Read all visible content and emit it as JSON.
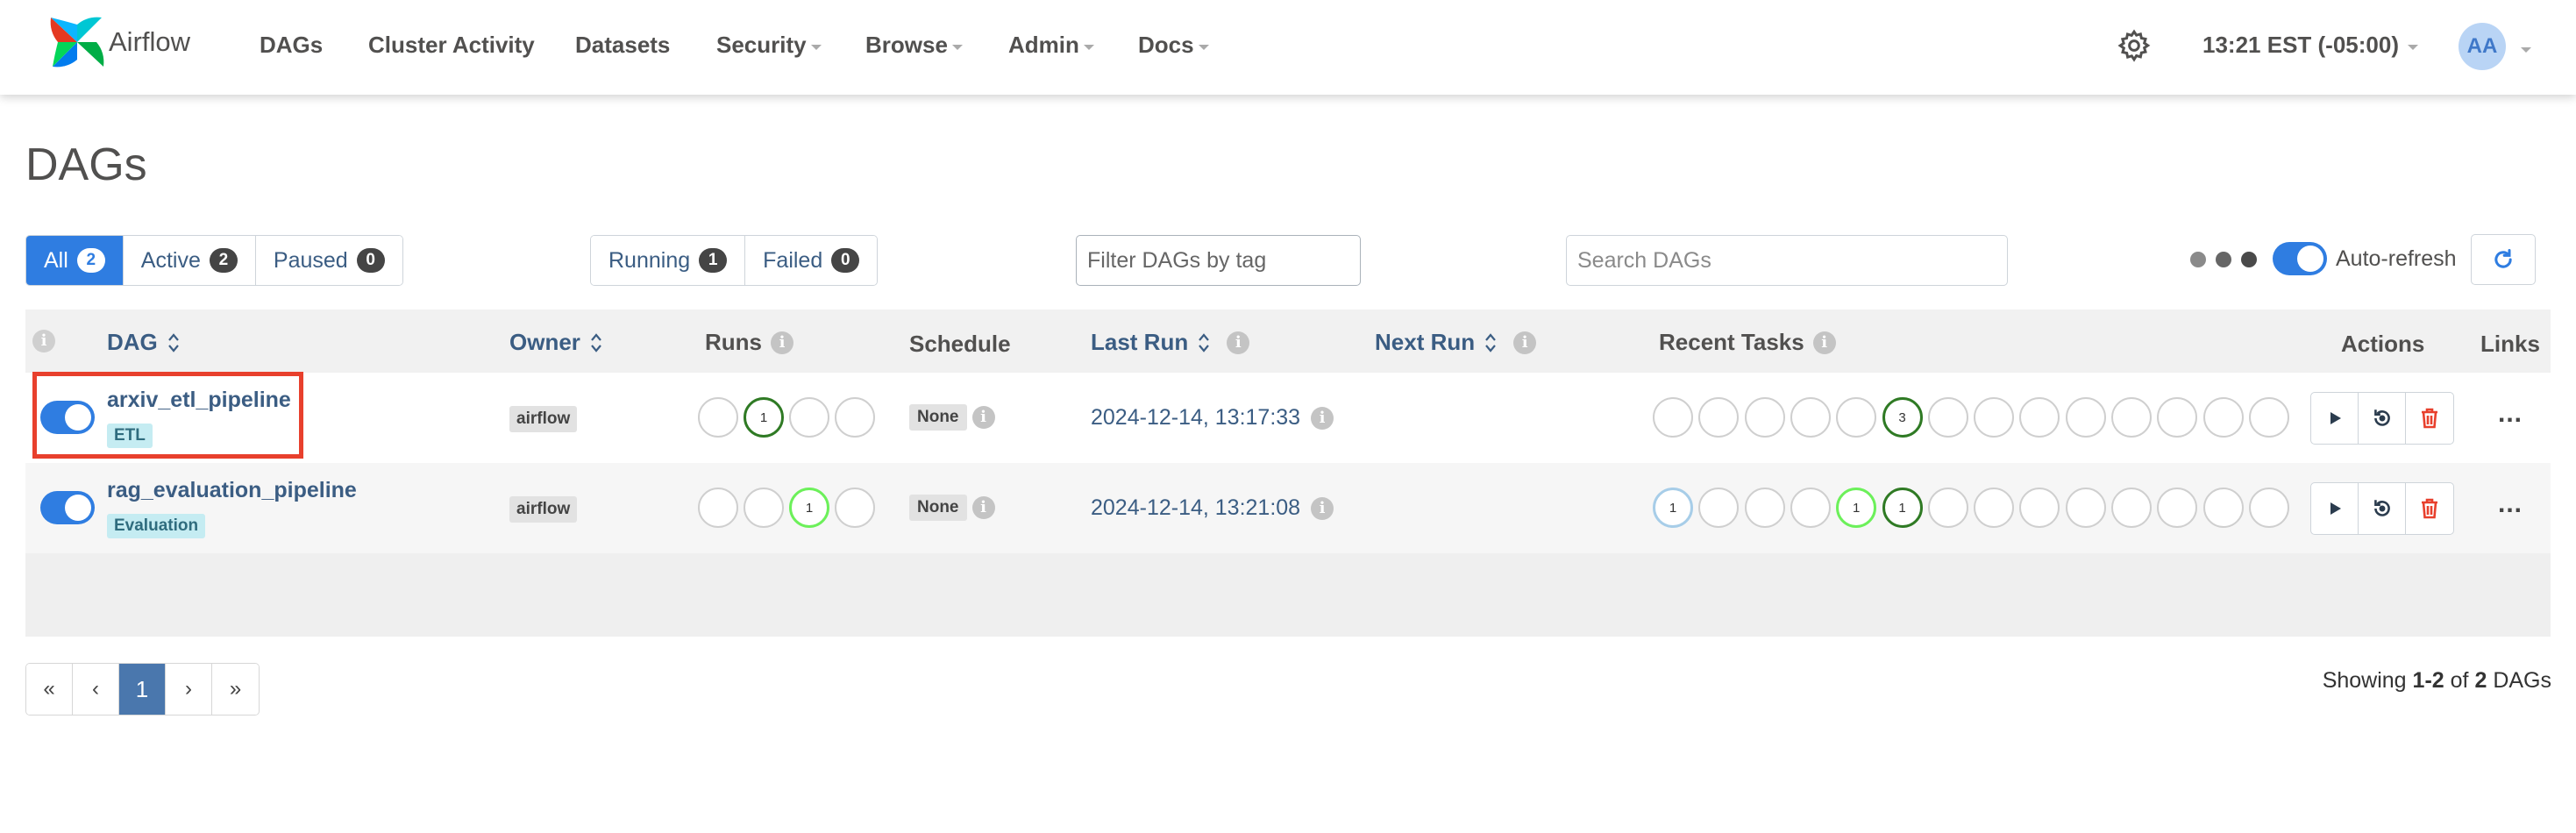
{
  "brand": {
    "name": "Airflow"
  },
  "nav": {
    "items": [
      {
        "label": "DAGs",
        "dropdown": false
      },
      {
        "label": "Cluster Activity",
        "dropdown": false
      },
      {
        "label": "Datasets",
        "dropdown": false
      },
      {
        "label": "Security",
        "dropdown": true
      },
      {
        "label": "Browse",
        "dropdown": true
      },
      {
        "label": "Admin",
        "dropdown": true
      },
      {
        "label": "Docs",
        "dropdown": true
      }
    ],
    "time": "13:21 EST (-05:00)",
    "user_initials": "AA"
  },
  "page": {
    "title": "DAGs"
  },
  "filters": {
    "status": [
      {
        "label": "All",
        "count": "2",
        "active": true
      },
      {
        "label": "Active",
        "count": "2",
        "active": false
      },
      {
        "label": "Paused",
        "count": "0",
        "active": false
      }
    ],
    "runs": [
      {
        "label": "Running",
        "count": "1"
      },
      {
        "label": "Failed",
        "count": "0"
      }
    ],
    "tag_placeholder": "Filter DAGs by tag",
    "search_placeholder": "Search DAGs",
    "auto_refresh_label": "Auto-refresh",
    "auto_refresh_on": true
  },
  "table": {
    "headers": {
      "dag": "DAG",
      "owner": "Owner",
      "runs": "Runs",
      "schedule": "Schedule",
      "last_run": "Last Run",
      "next_run": "Next Run",
      "recent_tasks": "Recent Tasks",
      "actions": "Actions",
      "links": "Links"
    },
    "rows": [
      {
        "dag_id": "arxiv_etl_pipeline",
        "tag": "ETL",
        "enabled": true,
        "owner": "airflow",
        "runs": [
          {
            "label": "",
            "state": "none"
          },
          {
            "label": "1",
            "state": "success"
          },
          {
            "label": "",
            "state": "none"
          },
          {
            "label": "",
            "state": "none"
          }
        ],
        "schedule": "None",
        "last_run": "2024-12-14, 13:17:33",
        "next_run": "",
        "recent_tasks": [
          {
            "label": "",
            "state": "none"
          },
          {
            "label": "",
            "state": "none"
          },
          {
            "label": "",
            "state": "none"
          },
          {
            "label": "",
            "state": "none"
          },
          {
            "label": "",
            "state": "none"
          },
          {
            "label": "3",
            "state": "success"
          },
          {
            "label": "",
            "state": "none"
          },
          {
            "label": "",
            "state": "none"
          },
          {
            "label": "",
            "state": "none"
          },
          {
            "label": "",
            "state": "none"
          },
          {
            "label": "",
            "state": "none"
          },
          {
            "label": "",
            "state": "none"
          },
          {
            "label": "",
            "state": "none"
          },
          {
            "label": "",
            "state": "none"
          }
        ],
        "links_label": "..."
      },
      {
        "dag_id": "rag_evaluation_pipeline",
        "tag": "Evaluation",
        "enabled": true,
        "owner": "airflow",
        "runs": [
          {
            "label": "",
            "state": "none"
          },
          {
            "label": "",
            "state": "none"
          },
          {
            "label": "1",
            "state": "running"
          },
          {
            "label": "",
            "state": "none"
          }
        ],
        "schedule": "None",
        "last_run": "2024-12-14, 13:21:08",
        "next_run": "",
        "recent_tasks": [
          {
            "label": "1",
            "state": "queued"
          },
          {
            "label": "",
            "state": "none"
          },
          {
            "label": "",
            "state": "none"
          },
          {
            "label": "",
            "state": "none"
          },
          {
            "label": "1",
            "state": "running"
          },
          {
            "label": "1",
            "state": "success"
          },
          {
            "label": "",
            "state": "none"
          },
          {
            "label": "",
            "state": "none"
          },
          {
            "label": "",
            "state": "none"
          },
          {
            "label": "",
            "state": "none"
          },
          {
            "label": "",
            "state": "none"
          },
          {
            "label": "",
            "state": "none"
          },
          {
            "label": "",
            "state": "none"
          },
          {
            "label": "",
            "state": "none"
          }
        ],
        "links_label": "..."
      }
    ]
  },
  "pagination": {
    "first": "«",
    "prev": "‹",
    "current": "1",
    "next": "›",
    "last": "»",
    "showing_prefix": "Showing",
    "range": "1-2",
    "of": "of",
    "total": "2",
    "suffix": "DAGs"
  },
  "colors": {
    "primary": "#2f7de1",
    "link": "#3b5d83",
    "success": "#2f7a24",
    "running": "#6cf05a",
    "queued": "#a7cde8",
    "delete": "#e8402d"
  }
}
